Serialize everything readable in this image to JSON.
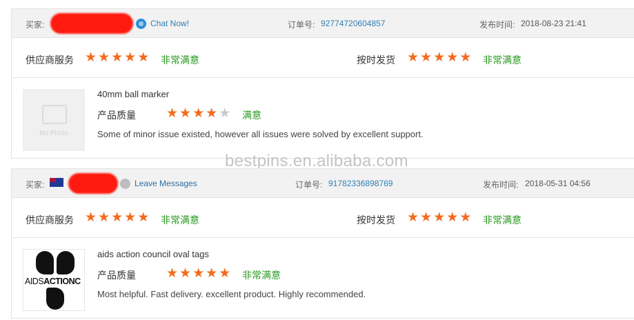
{
  "orders": [
    {
      "buyer_label": "买家:",
      "contact_label": "Chat Now!",
      "order_label": "订单号:",
      "order_no": "92774720604857",
      "time_label": "发布时间:",
      "time": "2018-08-23 21:41",
      "supplier_service_label": "供应商服务",
      "supplier_service_stars": 5,
      "supplier_service_rating": "非常满意",
      "ontime_label": "按时发货",
      "ontime_stars": 5,
      "ontime_rating": "非常满意",
      "product_name": "40mm ball marker",
      "quality_label": "产品质量",
      "quality_stars": 4,
      "quality_rating": "满意",
      "comment": "Some of minor issue existed, however all issues were solved by excellent support.",
      "thumb_text": "No Photo"
    },
    {
      "buyer_label": "买家:",
      "contact_label": "Leave Messages",
      "order_label": "订单号:",
      "order_no": "91782336898769",
      "time_label": "发布时间:",
      "time": "2018-05-31 04:56",
      "supplier_service_label": "供应商服务",
      "supplier_service_stars": 5,
      "supplier_service_rating": "非常满意",
      "ontime_label": "按时发货",
      "ontime_stars": 5,
      "ontime_rating": "非常满意",
      "product_name": "aids action council oval tags",
      "quality_label": "产品质量",
      "quality_stars": 5,
      "quality_rating": "非常满意",
      "comment": "Most helpful. Fast delivery. excellent product. Highly recommended.",
      "logo_text_1": "AIDS",
      "logo_text_2": "ACTION",
      "logo_text_3": "C"
    }
  ],
  "watermark": "bestpins.en.alibaba.com",
  "colors": {
    "star_on": "#f26b1d",
    "star_off": "#c8c8c8",
    "rating_green": "#2a9a22",
    "link_blue": "#2f7fb5",
    "redaction_red": "#ff1a10"
  }
}
